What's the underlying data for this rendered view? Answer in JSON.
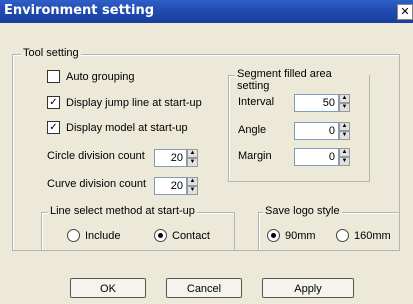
{
  "window": {
    "title": "Environment setting",
    "close_glyph": "✕"
  },
  "tool_setting": {
    "legend": "Tool setting",
    "auto_grouping": {
      "label": "Auto grouping",
      "checked": false
    },
    "display_jump_line": {
      "label": "Display jump line at start-up",
      "checked": true
    },
    "display_model": {
      "label": "Display model at start-up",
      "checked": true
    },
    "circle_division": {
      "label": "Circle division count",
      "value": "20"
    },
    "curve_division": {
      "label": "Curve division count",
      "value": "20"
    }
  },
  "segment": {
    "legend": "Segment filled area setting",
    "interval": {
      "label": "Interval",
      "value": "50"
    },
    "angle": {
      "label": "Angle",
      "value": "0"
    },
    "margin": {
      "label": "Margin",
      "value": "0"
    }
  },
  "line_select": {
    "legend": "Line select method at start-up",
    "include": {
      "label": "Include",
      "selected": false
    },
    "contact": {
      "label": "Contact",
      "selected": true
    }
  },
  "save_logo": {
    "legend": "Save logo style",
    "opt_90": {
      "label": "90mm",
      "selected": true
    },
    "opt_160": {
      "label": "160mm",
      "selected": false
    }
  },
  "buttons": {
    "ok": "OK",
    "cancel": "Cancel",
    "apply": "Apply"
  }
}
